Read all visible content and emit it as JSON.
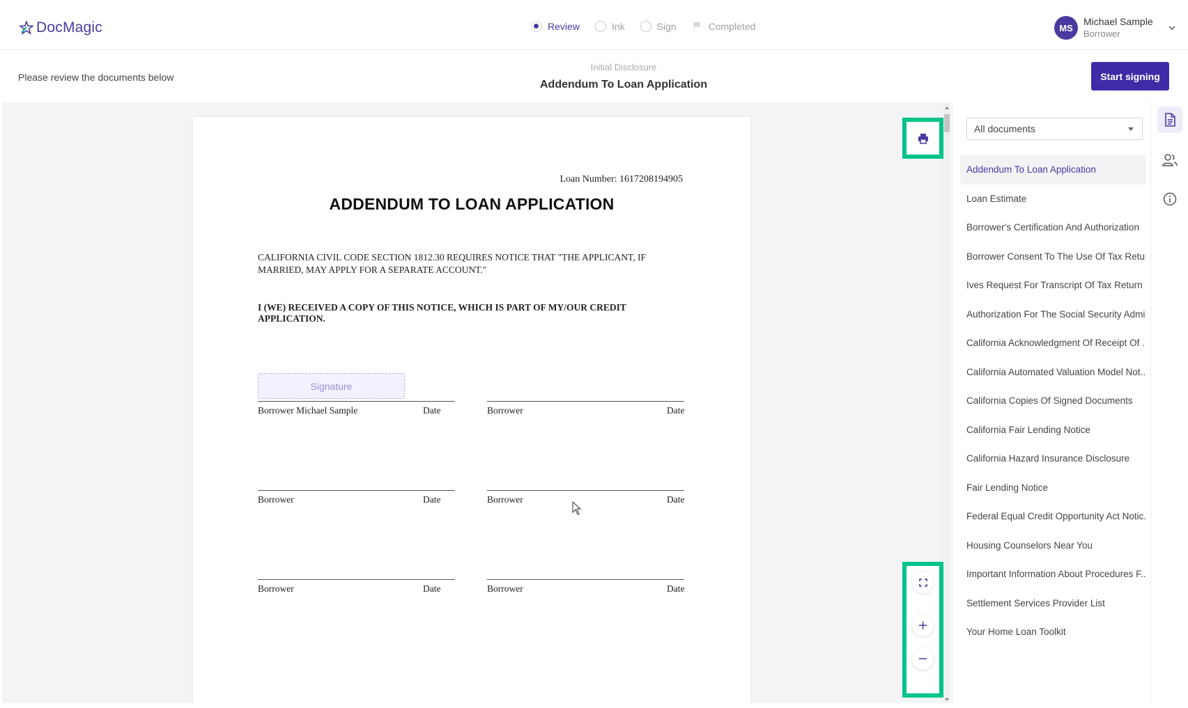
{
  "brand": {
    "name": "DocMagic",
    "color": "#4a3aa0"
  },
  "steps": [
    {
      "label": "Review",
      "state": "active"
    },
    {
      "label": "Ink",
      "state": "pending"
    },
    {
      "label": "Sign",
      "state": "pending"
    },
    {
      "label": "Completed",
      "state": "pending"
    }
  ],
  "user": {
    "initials": "MS",
    "name": "Michael Sample",
    "role": "Borrower"
  },
  "subheader": {
    "instruction": "Please review the documents below",
    "category": "Initial Disclosure",
    "title": "Addendum To Loan Application",
    "start_button": "Start signing"
  },
  "document": {
    "loan_number": "Loan Number: 1617208194905",
    "heading": "ADDENDUM TO LOAN APPLICATION",
    "notice": "CALIFORNIA CIVIL CODE SECTION 1812.30 REQUIRES NOTICE THAT \"THE APPLICANT, IF MARRIED, MAY APPLY FOR A SEPARATE ACCOUNT.\"",
    "received": "I (WE) RECEIVED A COPY OF THIS NOTICE, WHICH IS PART OF MY/OUR CREDIT APPLICATION.",
    "signature_field": "Signature",
    "date_label": "Date",
    "signature_blocks": [
      "Borrower Michael Sample",
      "Borrower",
      "Borrower",
      "Borrower",
      "Borrower",
      "Borrower"
    ]
  },
  "tools": {
    "print": "printer-icon",
    "fullscreen": "fullscreen-icon",
    "zoom_in": "+",
    "zoom_out": "−",
    "highlight_color": "#00c48c"
  },
  "doclist": {
    "filter": "All documents",
    "items": [
      "Addendum To Loan Application",
      "Loan Estimate",
      "Borrower's Certification And Authorization",
      "Borrower Consent To The Use Of Tax Retur...",
      "Ives Request For Transcript Of Tax Return",
      "Authorization For The Social Security Admi...",
      "California Acknowledgment Of Receipt Of ...",
      "California Automated Valuation Model Not...",
      "California Copies Of Signed Documents",
      "California Fair Lending Notice",
      "California Hazard Insurance Disclosure",
      "Fair Lending Notice",
      "Federal Equal Credit Opportunity Act Notic...",
      "Housing Counselors Near You",
      "Important Information About Procedures F...",
      "Settlement Services Provider List",
      "Your Home Loan Toolkit"
    ],
    "active_index": 0
  }
}
